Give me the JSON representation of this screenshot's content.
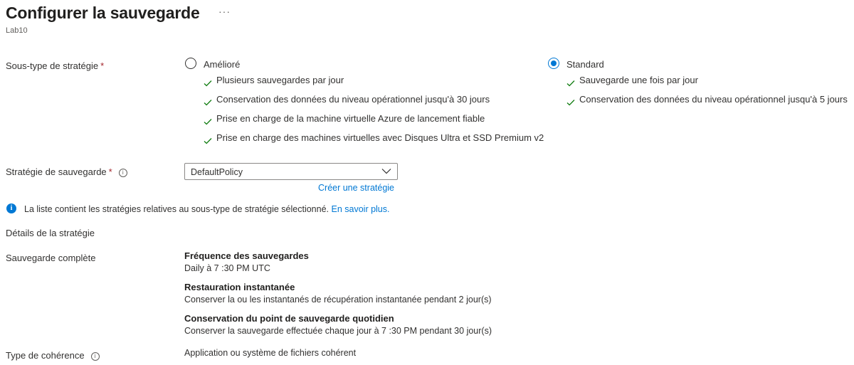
{
  "header": {
    "title": "Configurer la sauvegarde",
    "more": "···",
    "subtitle": "Lab10"
  },
  "policy_subtype": {
    "label": "Sous-type de stratégie",
    "required_mark": "*",
    "options": [
      {
        "label": "Amélioré",
        "selected": false,
        "features": [
          "Plusieurs sauvegardes par jour",
          "Conservation des données du niveau opérationnel jusqu'à 30 jours",
          "Prise en charge de la machine virtuelle Azure de lancement fiable",
          "Prise en charge des machines virtuelles avec Disques Ultra et SSD Premium v2"
        ]
      },
      {
        "label": "Standard",
        "selected": true,
        "features": [
          "Sauvegarde une fois par jour",
          "Conservation des données du niveau opérationnel jusqu'à 5 jours"
        ]
      }
    ]
  },
  "backup_policy": {
    "label": "Stratégie de sauvegarde",
    "required_mark": "*",
    "info_icon": "i",
    "selected_value": "DefaultPolicy",
    "create_link": "Créer une stratégie"
  },
  "info_banner": {
    "icon": "i",
    "text": "La liste contient les stratégies relatives au sous-type de stratégie sélectionné.",
    "link": "En savoir plus."
  },
  "policy_details": {
    "heading": "Détails de la stratégie",
    "full_backup_label": "Sauvegarde complète",
    "items": [
      {
        "title": "Fréquence des sauvegardes",
        "value": "Daily à 7 :30 PM UTC"
      },
      {
        "title": "Restauration instantanée",
        "value": "Conserver la ou les instantanés de récupération instantanée pendant 2 jour(s)"
      },
      {
        "title": "Conservation du point de sauvegarde quotidien",
        "value": "Conserver la sauvegarde effectuée chaque jour à 7 :30 PM pendant 30 jour(s)"
      }
    ],
    "consistency_label": "Type de cohérence",
    "consistency_info_icon": "i",
    "consistency_value": "Application ou système de fichiers cohérent"
  },
  "colors": {
    "accent": "#0078d4",
    "check": "#107c10",
    "required": "#a4262c"
  }
}
